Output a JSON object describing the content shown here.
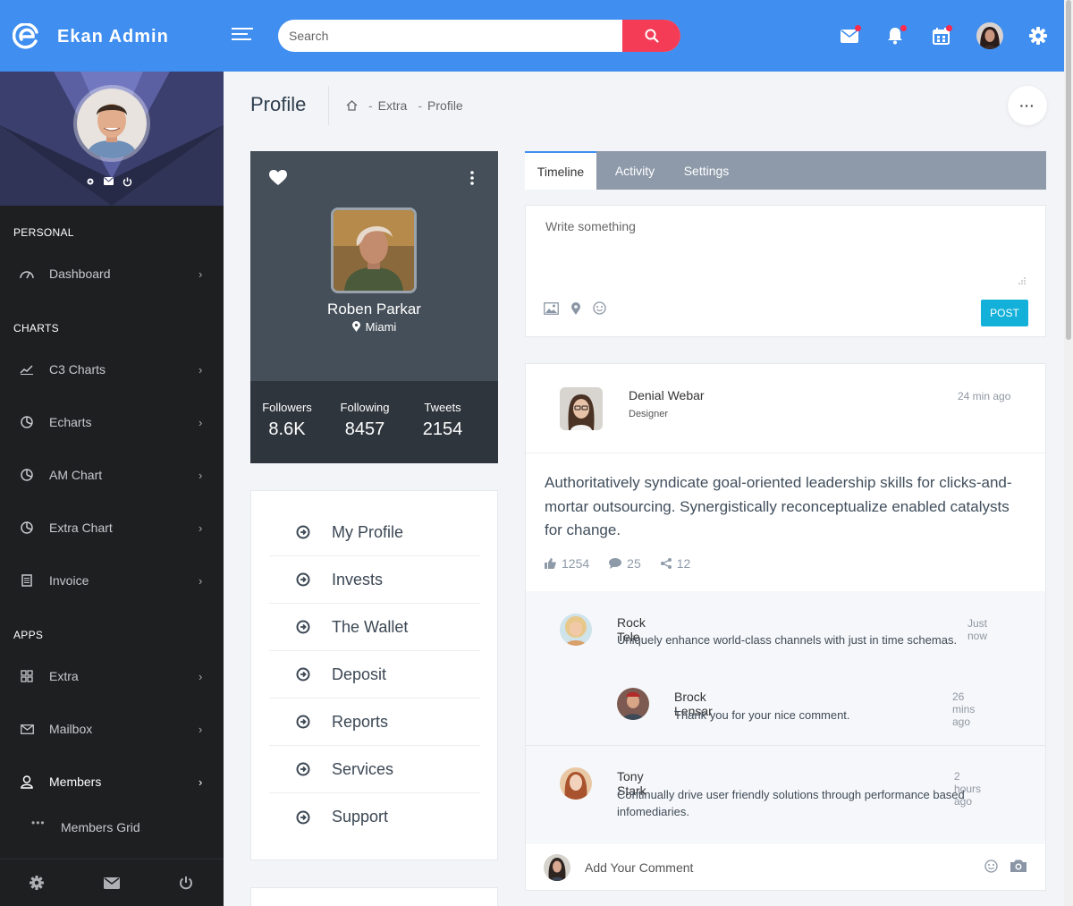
{
  "app": {
    "brand": "Ekan Admin"
  },
  "search": {
    "placeholder": "Search"
  },
  "sidebar": {
    "sections": [
      {
        "title": "PERSONAL"
      },
      {
        "title": "CHARTS"
      },
      {
        "title": "APPS"
      }
    ],
    "items": [
      {
        "label": "Dashboard",
        "icon": "gauge-icon"
      },
      {
        "label": "C3 Charts",
        "icon": "trend-icon"
      },
      {
        "label": "Echarts",
        "icon": "pie-icon"
      },
      {
        "label": "AM Chart",
        "icon": "pie-icon"
      },
      {
        "label": "Extra Chart",
        "icon": "pie-icon"
      },
      {
        "label": "Invoice",
        "icon": "document-icon"
      },
      {
        "label": "Extra",
        "icon": "grid-icon"
      },
      {
        "label": "Mailbox",
        "icon": "envelope-icon"
      },
      {
        "label": "Members",
        "icon": "user-icon"
      }
    ],
    "sub_items": [
      {
        "label": "Members Grid"
      }
    ],
    "chevron": "›"
  },
  "page": {
    "title": "Profile",
    "breadcrumb": [
      "Extra",
      "Profile"
    ],
    "more": "···"
  },
  "profile": {
    "name": "Roben Parkar",
    "location": "Miami",
    "stats": [
      {
        "label": "Followers",
        "value": "8.6K"
      },
      {
        "label": "Following",
        "value": "8457"
      },
      {
        "label": "Tweets",
        "value": "2154"
      }
    ]
  },
  "menu": [
    {
      "label": "My Profile"
    },
    {
      "label": "Invests"
    },
    {
      "label": "The Wallet"
    },
    {
      "label": "Deposit"
    },
    {
      "label": "Reports"
    },
    {
      "label": "Services"
    },
    {
      "label": "Support"
    }
  ],
  "tabs": [
    {
      "label": "Timeline",
      "active": true
    },
    {
      "label": "Activity",
      "active": false
    },
    {
      "label": "Settings",
      "active": false
    }
  ],
  "composer": {
    "placeholder": "Write something",
    "post_label": "POST"
  },
  "post": {
    "author": "Denial Webar",
    "role": "Designer",
    "time": "24 min ago",
    "body": "Authoritatively syndicate goal-oriented leadership skills for clicks-and-mortar outsourcing. Synergistically reconceptualize enabled catalysts for change.",
    "likes": "1254",
    "comments": "25",
    "shares": "12"
  },
  "comments": [
    {
      "name": "Rock Tele",
      "time": "Just now",
      "text": "Uniquely enhance world-class channels with just in time schemas."
    },
    {
      "name": "Brock Lensar",
      "time": "26 mins ago",
      "text": "Thank you for your nice comment."
    },
    {
      "name": "Tony Stark",
      "time": "2 hours ago",
      "text": "Continually drive user friendly solutions through performance based infomediaries."
    }
  ],
  "add_comment": {
    "placeholder": "Add Your Comment"
  },
  "colors": {
    "topbar": "#3f8ef0",
    "search_button": "#f43c57",
    "sidebar": "#1e1f21",
    "post_button": "#13b1d9",
    "notification_dot": "#ff2a4b"
  }
}
